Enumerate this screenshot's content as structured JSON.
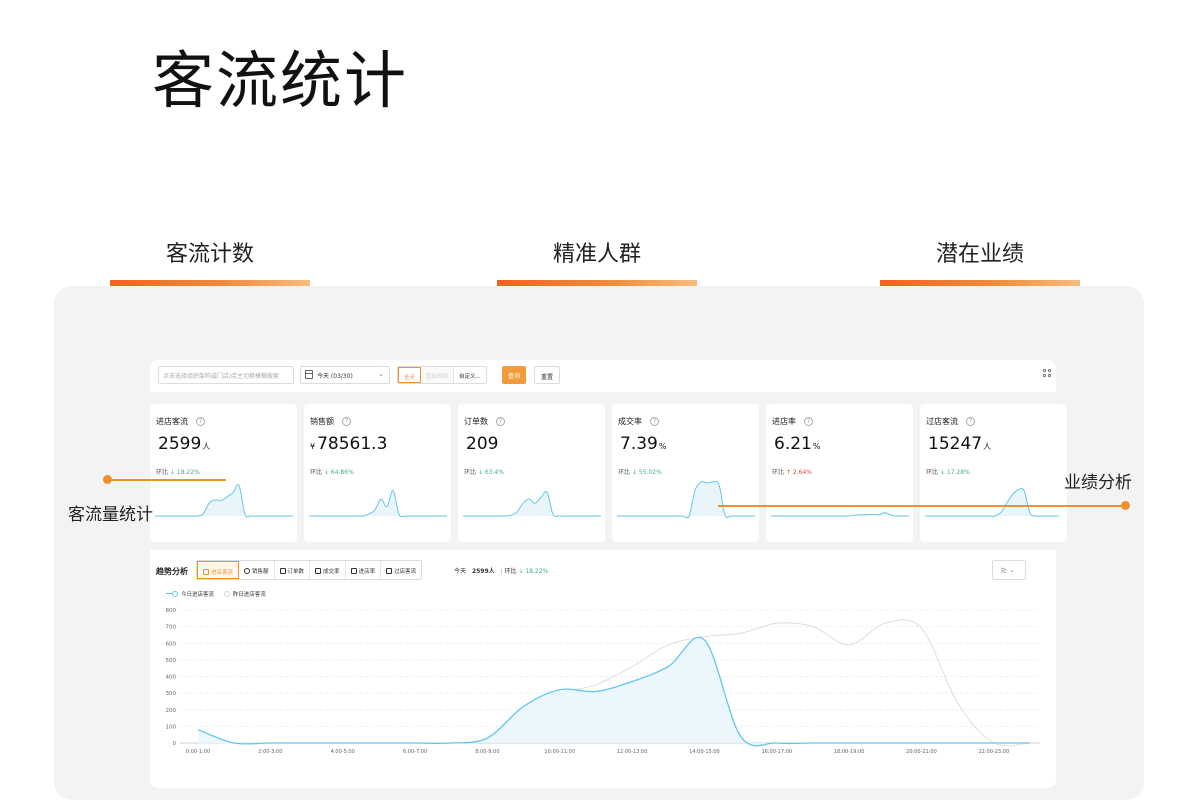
{
  "page_title": "客流统计",
  "sections": [
    "客流计数",
    "精准人群",
    "潜在业绩"
  ],
  "filter_bar": {
    "search_placeholder": "点击选择组织架构或门店/店主切换模糊搜索",
    "date_value": "今天 (03/30)",
    "segments": [
      {
        "label": "全天",
        "state": "active"
      },
      {
        "label": "营业时间",
        "state": "disabled"
      },
      {
        "label": "自定义...",
        "state": "normal"
      }
    ],
    "query_label": "查询",
    "reset_label": "重置"
  },
  "cards": [
    {
      "title": "进店客流",
      "value": "2599",
      "unit": "人",
      "currency": "",
      "compare_label": "环比",
      "arrow": "↓",
      "change": "18.22%",
      "direction": "down"
    },
    {
      "title": "销售额",
      "value": "78561.3",
      "unit": "",
      "currency": "¥",
      "compare_label": "环比",
      "arrow": "↓",
      "change": "64.86%",
      "direction": "down"
    },
    {
      "title": "订单数",
      "value": "209",
      "unit": "",
      "currency": "",
      "compare_label": "环比",
      "arrow": "↓",
      "change": "63.4%",
      "direction": "down"
    },
    {
      "title": "成交率",
      "value": "7.39",
      "unit": "%",
      "currency": "",
      "compare_label": "环比",
      "arrow": "↓",
      "change": "55.02%",
      "direction": "down"
    },
    {
      "title": "进店率",
      "value": "6.21",
      "unit": "%",
      "currency": "",
      "compare_label": "环比",
      "arrow": "↑",
      "change": "2.64%",
      "direction": "up"
    },
    {
      "title": "过店客流",
      "value": "15247",
      "unit": "人",
      "currency": "",
      "compare_label": "环比",
      "arrow": "↓",
      "change": "17.28%",
      "direction": "down"
    }
  ],
  "trend": {
    "title": "趋势分析",
    "tabs": [
      {
        "label": "进店客流",
        "active": true
      },
      {
        "label": "销售额",
        "active": false
      },
      {
        "label": "订单数",
        "active": false
      },
      {
        "label": "成交率",
        "active": false
      },
      {
        "label": "进店率",
        "active": false
      },
      {
        "label": "过店客流",
        "active": false
      }
    ],
    "summary_label": "今天",
    "summary_value": "2599人",
    "summary_compare_label": "环比",
    "summary_change": "↓ 18.22%",
    "legend_today": "今日进店客流",
    "legend_yesterday": "昨日进店客流",
    "chart_icon": "line-chart-icon"
  },
  "callouts": {
    "left": "客流量统计",
    "right": "业绩分析"
  },
  "colors": {
    "accent": "#f0902d",
    "series_today": "#67c6e8",
    "series_yesterday": "#dddddd",
    "down": "#3fb27f",
    "up": "#e8453c"
  },
  "chart_data": {
    "type": "area",
    "x_tick_labels": [
      "0:00-1:00",
      "2:00-3:00",
      "4:00-5:00",
      "6:00-7:00",
      "8:00-9:00",
      "10:00-11:00",
      "12:00-13:00",
      "14:00-15:00",
      "16:00-17:00",
      "18:00-19:00",
      "20:00-21:00",
      "22:00-23:00"
    ],
    "x": [
      "0:00-1:00",
      "1:00-2:00",
      "2:00-3:00",
      "3:00-4:00",
      "4:00-5:00",
      "5:00-6:00",
      "6:00-7:00",
      "7:00-8:00",
      "8:00-9:00",
      "9:00-10:00",
      "10:00-11:00",
      "11:00-12:00",
      "12:00-13:00",
      "13:00-14:00",
      "14:00-15:00",
      "15:00-16:00",
      "16:00-17:00",
      "17:00-18:00",
      "18:00-19:00",
      "19:00-20:00",
      "20:00-21:00",
      "21:00-22:00",
      "22:00-23:00",
      "23:00-24:00"
    ],
    "series": [
      {
        "name": "今日进店客流",
        "values": [
          80,
          0,
          0,
          0,
          0,
          0,
          0,
          0,
          30,
          220,
          320,
          310,
          370,
          460,
          620,
          40,
          0,
          0,
          0,
          0,
          0,
          0,
          0,
          0
        ]
      },
      {
        "name": "昨日进店客流",
        "values": [
          0,
          0,
          0,
          0,
          0,
          0,
          0,
          0,
          20,
          200,
          300,
          350,
          460,
          590,
          640,
          660,
          720,
          700,
          590,
          720,
          690,
          240,
          0,
          0
        ]
      }
    ],
    "yticks": [
      0,
      100,
      200,
      300,
      400,
      500,
      600,
      700,
      800
    ],
    "ylim": [
      0,
      800
    ],
    "grid": true,
    "legend_position": "top-left"
  },
  "sparklines": [
    [
      0,
      0,
      0,
      0,
      0,
      0,
      0,
      0,
      5,
      30,
      38,
      36,
      45,
      55,
      72,
      4,
      0,
      0,
      0,
      0,
      0,
      0,
      0,
      0
    ],
    [
      0,
      0,
      0,
      0,
      0,
      0,
      0,
      0,
      0,
      0,
      5,
      14,
      40,
      22,
      60,
      4,
      0,
      0,
      0,
      0,
      0,
      0,
      0,
      0
    ],
    [
      0,
      0,
      0,
      0,
      0,
      0,
      0,
      0,
      2,
      10,
      30,
      40,
      30,
      44,
      56,
      4,
      0,
      0,
      0,
      0,
      0,
      0,
      0,
      0
    ],
    [
      0,
      0,
      0,
      0,
      0,
      0,
      0,
      0,
      0,
      0,
      0,
      0,
      0,
      60,
      80,
      78,
      80,
      74,
      2,
      0,
      0,
      0,
      0,
      0
    ],
    [
      0,
      0,
      0,
      0,
      0,
      0,
      0,
      0,
      0,
      0,
      0,
      0,
      0,
      0,
      2,
      3,
      3,
      4,
      3,
      8,
      2,
      0,
      0,
      0
    ],
    [
      0,
      0,
      0,
      0,
      0,
      0,
      0,
      0,
      0,
      0,
      0,
      0,
      0,
      8,
      30,
      50,
      62,
      60,
      8,
      0,
      0,
      0,
      0,
      0
    ]
  ]
}
